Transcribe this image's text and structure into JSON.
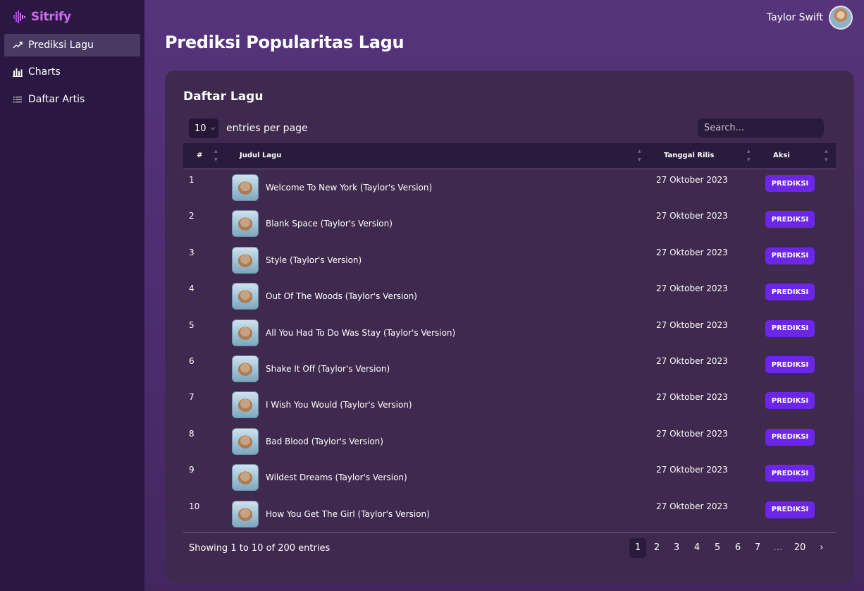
{
  "app": {
    "name": "Sitrify",
    "brand_color": "#c86be8"
  },
  "sidebar": {
    "items": [
      {
        "label": "Prediksi Lagu",
        "icon": "trending-up-icon",
        "active": true
      },
      {
        "label": "Charts",
        "icon": "bar-chart-icon",
        "active": false
      },
      {
        "label": "Daftar Artis",
        "icon": "list-icon",
        "active": false
      }
    ]
  },
  "header": {
    "user_name": "Taylor Swift"
  },
  "page": {
    "title": "Prediksi Popularitas Lagu"
  },
  "card": {
    "title": "Daftar Lagu",
    "per_page_value": "10",
    "per_page_label": "entries per page",
    "search_placeholder": "Search...",
    "columns": [
      "#",
      "Judul Lagu",
      "Tanggal Rilis",
      "Aksi"
    ],
    "rows": [
      {
        "num": "1",
        "title": "Welcome To New York (Taylor's Version)",
        "date": "27 Oktober 2023",
        "action": "PREDIKSI"
      },
      {
        "num": "2",
        "title": "Blank Space (Taylor's Version)",
        "date": "27 Oktober 2023",
        "action": "PREDIKSI"
      },
      {
        "num": "3",
        "title": "Style (Taylor's Version)",
        "date": "27 Oktober 2023",
        "action": "PREDIKSI"
      },
      {
        "num": "4",
        "title": "Out Of The Woods (Taylor's Version)",
        "date": "27 Oktober 2023",
        "action": "PREDIKSI"
      },
      {
        "num": "5",
        "title": "All You Had To Do Was Stay (Taylor's Version)",
        "date": "27 Oktober 2023",
        "action": "PREDIKSI"
      },
      {
        "num": "6",
        "title": "Shake It Off (Taylor's Version)",
        "date": "27 Oktober 2023",
        "action": "PREDIKSI"
      },
      {
        "num": "7",
        "title": "I Wish You Would (Taylor's Version)",
        "date": "27 Oktober 2023",
        "action": "PREDIKSI"
      },
      {
        "num": "8",
        "title": "Bad Blood (Taylor's Version)",
        "date": "27 Oktober 2023",
        "action": "PREDIKSI"
      },
      {
        "num": "9",
        "title": "Wildest Dreams (Taylor's Version)",
        "date": "27 Oktober 2023",
        "action": "PREDIKSI"
      },
      {
        "num": "10",
        "title": "How You Get The Girl (Taylor's Version)",
        "date": "27 Oktober 2023",
        "action": "PREDIKSI"
      }
    ],
    "showing_text": "Showing 1 to 10 of 200 entries",
    "pagination": [
      "1",
      "2",
      "3",
      "4",
      "5",
      "6",
      "7",
      "…",
      "20",
      "›"
    ],
    "current_page": "1",
    "button_color": "#6b26e8"
  }
}
